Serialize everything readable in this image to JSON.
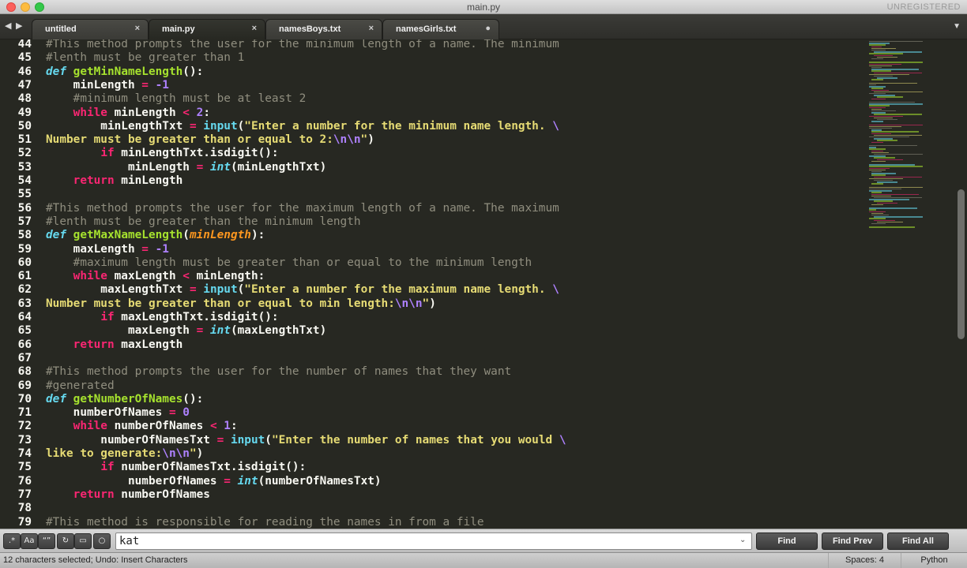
{
  "window": {
    "title": "main.py",
    "registration": "UNREGISTERED"
  },
  "tabs": [
    {
      "label": "untitled",
      "close": "×"
    },
    {
      "label": "main.py",
      "close": "×"
    },
    {
      "label": "namesBoys.txt",
      "close": "×"
    },
    {
      "label": "namesGirls.txt",
      "close": "●"
    }
  ],
  "icons": {
    "nav_left": "◀",
    "nav_right": "▶",
    "tab_menu": "▼",
    "opt_regex": ".*",
    "opt_case": "Aa",
    "opt_word": "“”",
    "opt_wrap": "↻",
    "opt_selection": "▭",
    "opt_highlight": "○",
    "find_history": "⌄"
  },
  "colors": {
    "background": "#272822",
    "keyword": "#f92672",
    "function": "#a6e22e",
    "string": "#e6db74",
    "number": "#ae81ff",
    "comment": "#908e7f",
    "builtin": "#66d9ef",
    "param": "#fd971f"
  },
  "editor": {
    "lines": [
      {
        "n": "44",
        "tokens": [
          [
            "cm",
            "#This method prompts the user for the minimum length of a name. The minimum"
          ]
        ]
      },
      {
        "n": "45",
        "tokens": [
          [
            "cm",
            "#lenth must be greater than 1"
          ]
        ]
      },
      {
        "n": "46",
        "tokens": [
          [
            "def",
            "def"
          ],
          [
            "",
            " "
          ],
          [
            "fn",
            "getMinNameLength"
          ],
          [
            "",
            "():"
          ]
        ]
      },
      {
        "n": "47",
        "tokens": [
          [
            "",
            "    minLength "
          ],
          [
            "kw",
            "="
          ],
          [
            "",
            " "
          ],
          [
            "num",
            "-1"
          ]
        ]
      },
      {
        "n": "48",
        "tokens": [
          [
            "",
            "    "
          ],
          [
            "cm",
            "#minimum length must be at least 2"
          ]
        ]
      },
      {
        "n": "49",
        "tokens": [
          [
            "",
            "    "
          ],
          [
            "kw",
            "while"
          ],
          [
            "",
            " minLength "
          ],
          [
            "kw",
            "<"
          ],
          [
            "",
            " "
          ],
          [
            "num",
            "2"
          ],
          [
            "",
            ":"
          ]
        ]
      },
      {
        "n": "50",
        "tokens": [
          [
            "",
            "        minLengthTxt "
          ],
          [
            "kw",
            "="
          ],
          [
            "",
            " "
          ],
          [
            "bi",
            "input"
          ],
          [
            "",
            "("
          ],
          [
            "str",
            "\"Enter a number for the minimum name length. "
          ],
          [
            "esc",
            "\\"
          ]
        ]
      },
      {
        "n": "51",
        "tokens": [
          [
            "str",
            "Number must be greater than or equal to 2:"
          ],
          [
            "esc",
            "\\n\\n"
          ],
          [
            "str",
            "\""
          ],
          [
            "",
            ")"
          ]
        ]
      },
      {
        "n": "52",
        "tokens": [
          [
            "",
            "        "
          ],
          [
            "kw",
            "if"
          ],
          [
            "",
            " minLengthTxt.isdigit():"
          ]
        ]
      },
      {
        "n": "53",
        "tokens": [
          [
            "",
            "            minLength "
          ],
          [
            "kw",
            "="
          ],
          [
            "",
            " "
          ],
          [
            "ty",
            "int"
          ],
          [
            "",
            "(minLengthTxt)"
          ]
        ]
      },
      {
        "n": "54",
        "tokens": [
          [
            "",
            "    "
          ],
          [
            "kw",
            "return"
          ],
          [
            "",
            " minLength"
          ]
        ]
      },
      {
        "n": "55",
        "tokens": []
      },
      {
        "n": "56",
        "tokens": [
          [
            "cm",
            "#This method prompts the user for the maximum length of a name. The maximum"
          ]
        ]
      },
      {
        "n": "57",
        "tokens": [
          [
            "cm",
            "#lenth must be greater than the minimum length"
          ]
        ]
      },
      {
        "n": "58",
        "tokens": [
          [
            "def",
            "def"
          ],
          [
            "",
            " "
          ],
          [
            "fn",
            "getMaxNameLength"
          ],
          [
            "",
            "("
          ],
          [
            "param",
            "minLength"
          ],
          [
            "",
            "):"
          ]
        ]
      },
      {
        "n": "59",
        "tokens": [
          [
            "",
            "    maxLength "
          ],
          [
            "kw",
            "="
          ],
          [
            "",
            " "
          ],
          [
            "num",
            "-1"
          ]
        ]
      },
      {
        "n": "60",
        "tokens": [
          [
            "",
            "    "
          ],
          [
            "cm",
            "#maximum length must be greater than or equal to the minimum length"
          ]
        ]
      },
      {
        "n": "61",
        "tokens": [
          [
            "",
            "    "
          ],
          [
            "kw",
            "while"
          ],
          [
            "",
            " maxLength "
          ],
          [
            "kw",
            "<"
          ],
          [
            "",
            " minLength:"
          ]
        ]
      },
      {
        "n": "62",
        "tokens": [
          [
            "",
            "        maxLengthTxt "
          ],
          [
            "kw",
            "="
          ],
          [
            "",
            " "
          ],
          [
            "bi",
            "input"
          ],
          [
            "",
            "("
          ],
          [
            "str",
            "\"Enter a number for the maximum name length. "
          ],
          [
            "esc",
            "\\"
          ]
        ]
      },
      {
        "n": "63",
        "tokens": [
          [
            "str",
            "Number must be greater than or equal to min length:"
          ],
          [
            "esc",
            "\\n\\n"
          ],
          [
            "str",
            "\""
          ],
          [
            "",
            ")"
          ]
        ]
      },
      {
        "n": "64",
        "tokens": [
          [
            "",
            "        "
          ],
          [
            "kw",
            "if"
          ],
          [
            "",
            " maxLengthTxt.isdigit():"
          ]
        ]
      },
      {
        "n": "65",
        "tokens": [
          [
            "",
            "            maxLength "
          ],
          [
            "kw",
            "="
          ],
          [
            "",
            " "
          ],
          [
            "ty",
            "int"
          ],
          [
            "",
            "(maxLengthTxt)"
          ]
        ]
      },
      {
        "n": "66",
        "tokens": [
          [
            "",
            "    "
          ],
          [
            "kw",
            "return"
          ],
          [
            "",
            " maxLength"
          ]
        ]
      },
      {
        "n": "67",
        "tokens": []
      },
      {
        "n": "68",
        "tokens": [
          [
            "cm",
            "#This method prompts the user for the number of names that they want"
          ]
        ]
      },
      {
        "n": "69",
        "tokens": [
          [
            "cm",
            "#generated"
          ]
        ]
      },
      {
        "n": "70",
        "tokens": [
          [
            "def",
            "def"
          ],
          [
            "",
            " "
          ],
          [
            "fn",
            "getNumberOfNames"
          ],
          [
            "",
            "():"
          ]
        ]
      },
      {
        "n": "71",
        "tokens": [
          [
            "",
            "    numberOfNames "
          ],
          [
            "kw",
            "="
          ],
          [
            "",
            " "
          ],
          [
            "num",
            "0"
          ]
        ]
      },
      {
        "n": "72",
        "tokens": [
          [
            "",
            "    "
          ],
          [
            "kw",
            "while"
          ],
          [
            "",
            " numberOfNames "
          ],
          [
            "kw",
            "<"
          ],
          [
            "",
            " "
          ],
          [
            "num",
            "1"
          ],
          [
            "",
            ":"
          ]
        ]
      },
      {
        "n": "73",
        "tokens": [
          [
            "",
            "        numberOfNamesTxt "
          ],
          [
            "kw",
            "="
          ],
          [
            "",
            " "
          ],
          [
            "bi",
            "input"
          ],
          [
            "",
            "("
          ],
          [
            "str",
            "\"Enter the number of names that you would "
          ],
          [
            "esc",
            "\\"
          ]
        ]
      },
      {
        "n": "74",
        "tokens": [
          [
            "str",
            "like to generate:"
          ],
          [
            "esc",
            "\\n\\n"
          ],
          [
            "str",
            "\""
          ],
          [
            "",
            ")"
          ]
        ]
      },
      {
        "n": "75",
        "tokens": [
          [
            "",
            "        "
          ],
          [
            "kw",
            "if"
          ],
          [
            "",
            " numberOfNamesTxt.isdigit():"
          ]
        ]
      },
      {
        "n": "76",
        "tokens": [
          [
            "",
            "            numberOfNames "
          ],
          [
            "kw",
            "="
          ],
          [
            "",
            " "
          ],
          [
            "ty",
            "int"
          ],
          [
            "",
            "(numberOfNamesTxt)"
          ]
        ]
      },
      {
        "n": "77",
        "tokens": [
          [
            "",
            "    "
          ],
          [
            "kw",
            "return"
          ],
          [
            "",
            " numberOfNames"
          ]
        ]
      },
      {
        "n": "78",
        "tokens": []
      },
      {
        "n": "79",
        "tokens": [
          [
            "cm",
            "#This method is responsible for reading the names in from a file"
          ]
        ]
      }
    ]
  },
  "find": {
    "value": "kat",
    "buttons": {
      "find": "Find",
      "find_prev": "Find Prev",
      "find_all": "Find All"
    }
  },
  "status": {
    "message": "12 characters selected; Undo: Insert Characters",
    "spaces": "Spaces: 4",
    "syntax": "Python"
  }
}
